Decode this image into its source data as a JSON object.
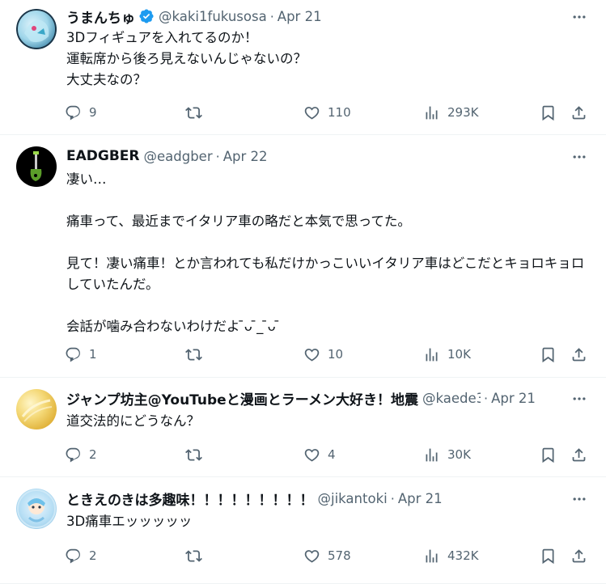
{
  "colors": {
    "text": "#0f1419",
    "muted": "#536471",
    "verified": "#1d9bf0",
    "divider": "#eff3f4"
  },
  "icons": [
    "reply-icon",
    "retweet-icon",
    "like-icon",
    "views-icon",
    "bookmark-icon",
    "share-icon",
    "more-icon",
    "verified-badge-icon"
  ],
  "tweets": [
    {
      "name": "うまんちゅ",
      "verified": true,
      "handle": "@kaki1fukusosa",
      "separator": "·",
      "date": "Apr 21",
      "text": "3Dフィギュアを入れてるのか！\n運転席から後ろ見えないんじゃないの？\n大丈夫なの？",
      "replies": "9",
      "retweets": "",
      "likes": "110",
      "views": "293K"
    },
    {
      "name": "EADGBER",
      "verified": false,
      "handle": "@eadgber",
      "separator": "·",
      "date": "Apr 22",
      "text": "凄い…\n\n痛車って、最近までイタリア車の略だと本気で思ってた。\n\n見て！凄い痛車！とか言われても私だけかっこいいイタリア車はどこだとキョロキョロしていたんだ。\n\n会話が噛み合わないわけだよ ̄ᴗ ̄_ ̄ᴗ ̄",
      "replies": "1",
      "retweets": "",
      "likes": "10",
      "views": "10K"
    },
    {
      "name": "ジャンプ坊主@YouTubeと漫画とラーメン大好き！地震",
      "verified": false,
      "handle": "@kaede3",
      "separator": "·",
      "date": "Apr 21",
      "text": "道交法的にどうなん？",
      "replies": "2",
      "retweets": "",
      "likes": "4",
      "views": "30K"
    },
    {
      "name": "ときえのきは多趣味！！！！！！！！！",
      "verified": false,
      "handle": "@jikantoki",
      "separator": "·",
      "date": "Apr 21",
      "text": "3D痛車エッッッッッ",
      "replies": "2",
      "retweets": "",
      "likes": "578",
      "views": "432K"
    }
  ]
}
